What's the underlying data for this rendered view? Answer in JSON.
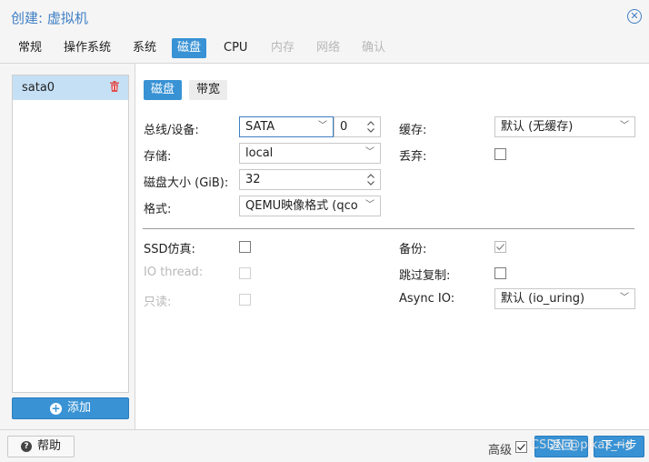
{
  "window": {
    "title": "创建: 虚拟机"
  },
  "tabs": [
    {
      "label": "常规"
    },
    {
      "label": "操作系统"
    },
    {
      "label": "系统"
    },
    {
      "label": "磁盘"
    },
    {
      "label": "CPU"
    },
    {
      "label": "内存"
    },
    {
      "label": "网络"
    },
    {
      "label": "确认"
    }
  ],
  "disks": {
    "items": [
      {
        "label": "sata0"
      }
    ],
    "add_label": "添加"
  },
  "subtabs": [
    {
      "label": "磁盘"
    },
    {
      "label": "带宽"
    }
  ],
  "form": {
    "bus_label": "总线/设备:",
    "bus_value": "SATA",
    "device_value": "0",
    "storage_label": "存储:",
    "storage_value": "local",
    "size_label": "磁盘大小 (GiB):",
    "size_value": "32",
    "format_label": "格式:",
    "format_value": "QEMU映像格式 (qco",
    "cache_label": "缓存:",
    "cache_value": "默认 (无缓存)",
    "discard_label": "丢弃:",
    "discard_checked": false,
    "ssd_label": "SSD仿真:",
    "ssd_checked": false,
    "iothread_label": "IO thread:",
    "readonly_label": "只读:",
    "backup_label": "备份:",
    "backup_checked": true,
    "skip_replication_label": "跳过复制:",
    "skip_replication_checked": false,
    "async_io_label": "Async IO:",
    "async_io_value": "默认 (io_uring)"
  },
  "footer": {
    "help_label": "帮助",
    "advanced_label": "高级",
    "advanced_checked": true,
    "back_label": "返回",
    "next_label": "下一步",
    "watermark": "CSDN @pikaz_rio"
  },
  "colors": {
    "accent": "#3892d4",
    "title": "#3f7fc4",
    "selected_row": "#c5e0f5",
    "delete_icon": "#e05050"
  }
}
